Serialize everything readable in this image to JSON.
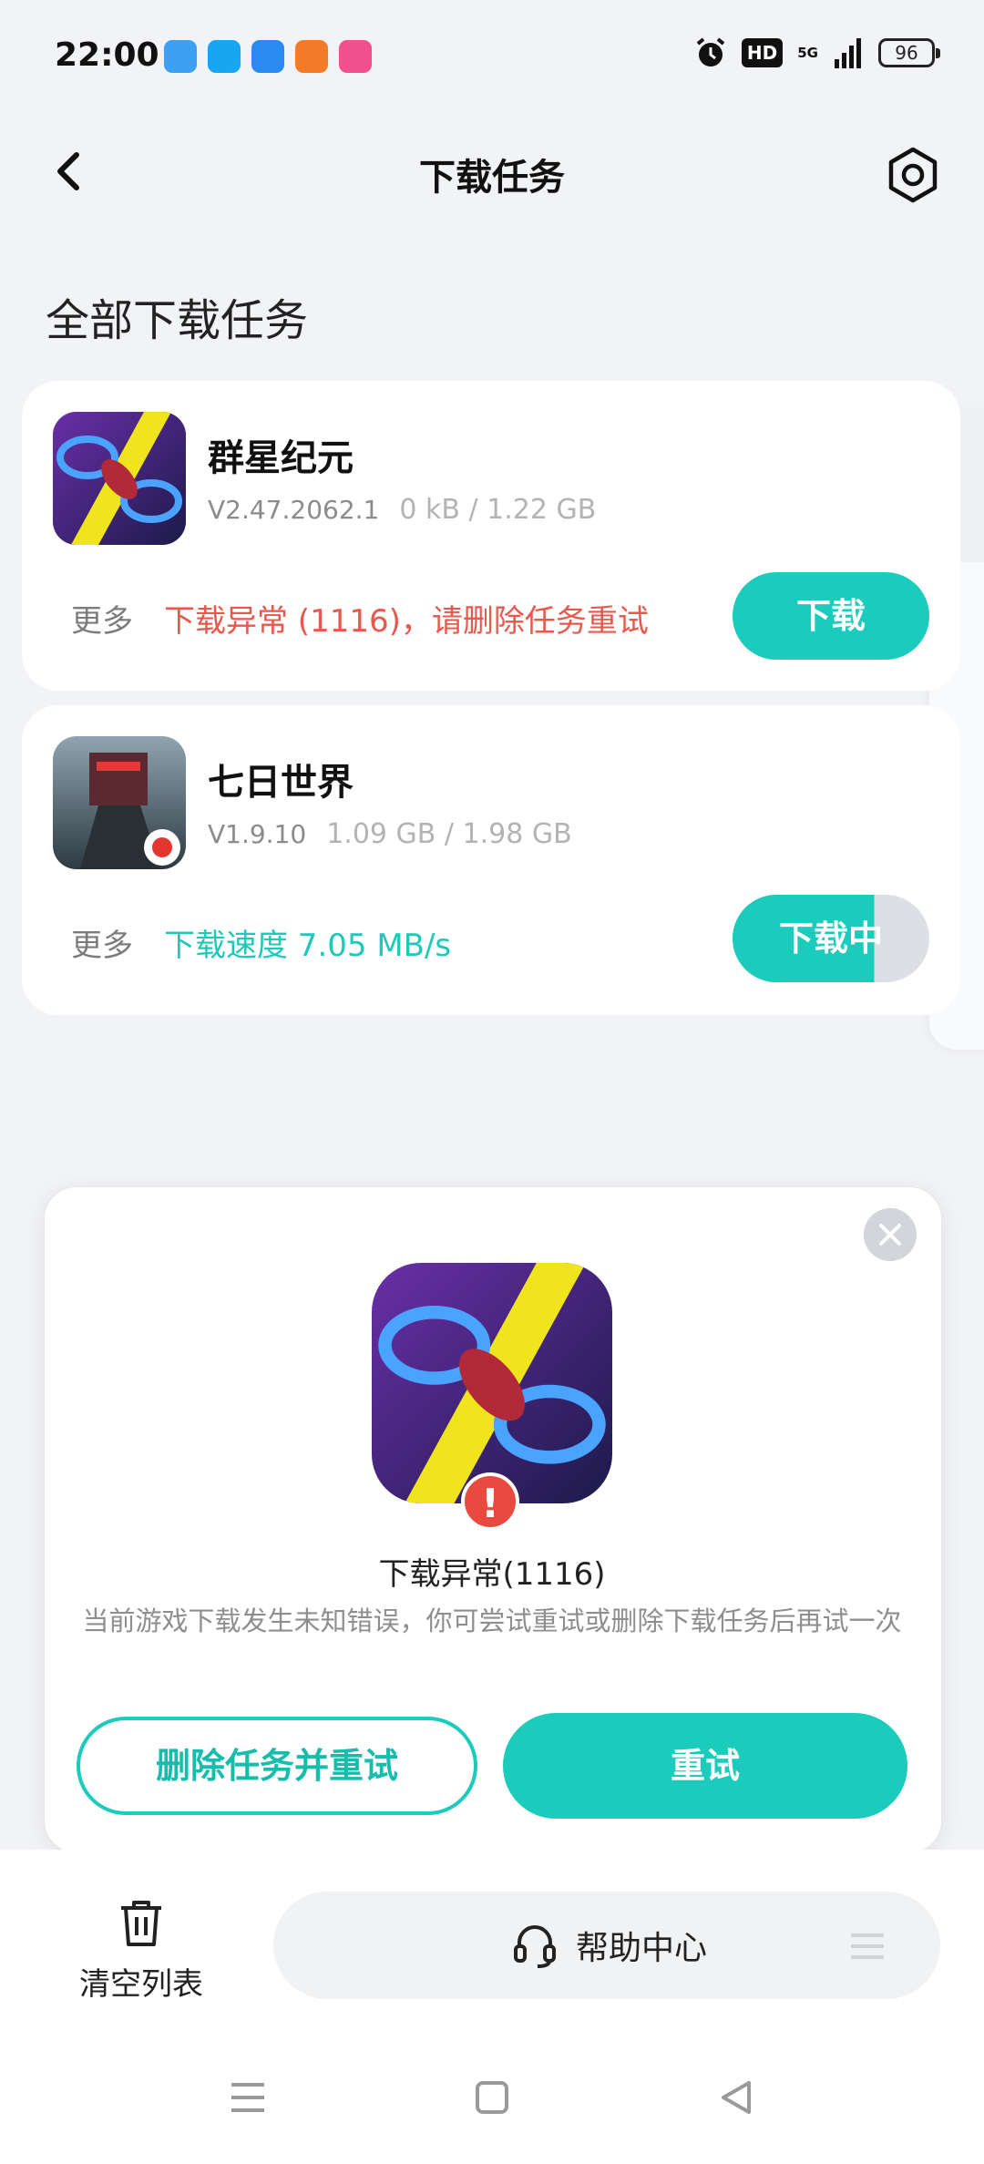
{
  "status_bar": {
    "time": "22:00",
    "hd": "HD",
    "network": "5G",
    "battery": "96",
    "app_colors": [
      "#3ea0f2",
      "#19a6f0",
      "#2a8af2",
      "#f27b2a",
      "#f0508c"
    ]
  },
  "header": {
    "title": "下载任务"
  },
  "section_title": "全部下载任务",
  "tasks": [
    {
      "name": "群星纪元",
      "version": "V2.47.2062.1",
      "size": "0 kB / 1.22 GB",
      "more": "更多",
      "status": "下载异常 (1116)，请删除任务重试",
      "button": "下载",
      "progress": 0
    },
    {
      "name": "七日世界",
      "version": "V1.9.10",
      "size": "1.09 GB / 1.98 GB",
      "more": "更多",
      "status": "下载速度 7.05 MB/s",
      "button": "下载中",
      "progress": 0.55
    }
  ],
  "dialog": {
    "title": "下载异常(1116)",
    "description": "当前游戏下载发生未知错误，你可尝试重试或删除下载任务后再试一次",
    "delete_retry_label": "删除任务并重试",
    "retry_label": "重试"
  },
  "bottom": {
    "clear_label": "清空列表",
    "help_label": "帮助中心"
  },
  "colors": {
    "accent": "#1bcbbb",
    "error": "#e8584c",
    "speed": "#1ec9b9"
  }
}
